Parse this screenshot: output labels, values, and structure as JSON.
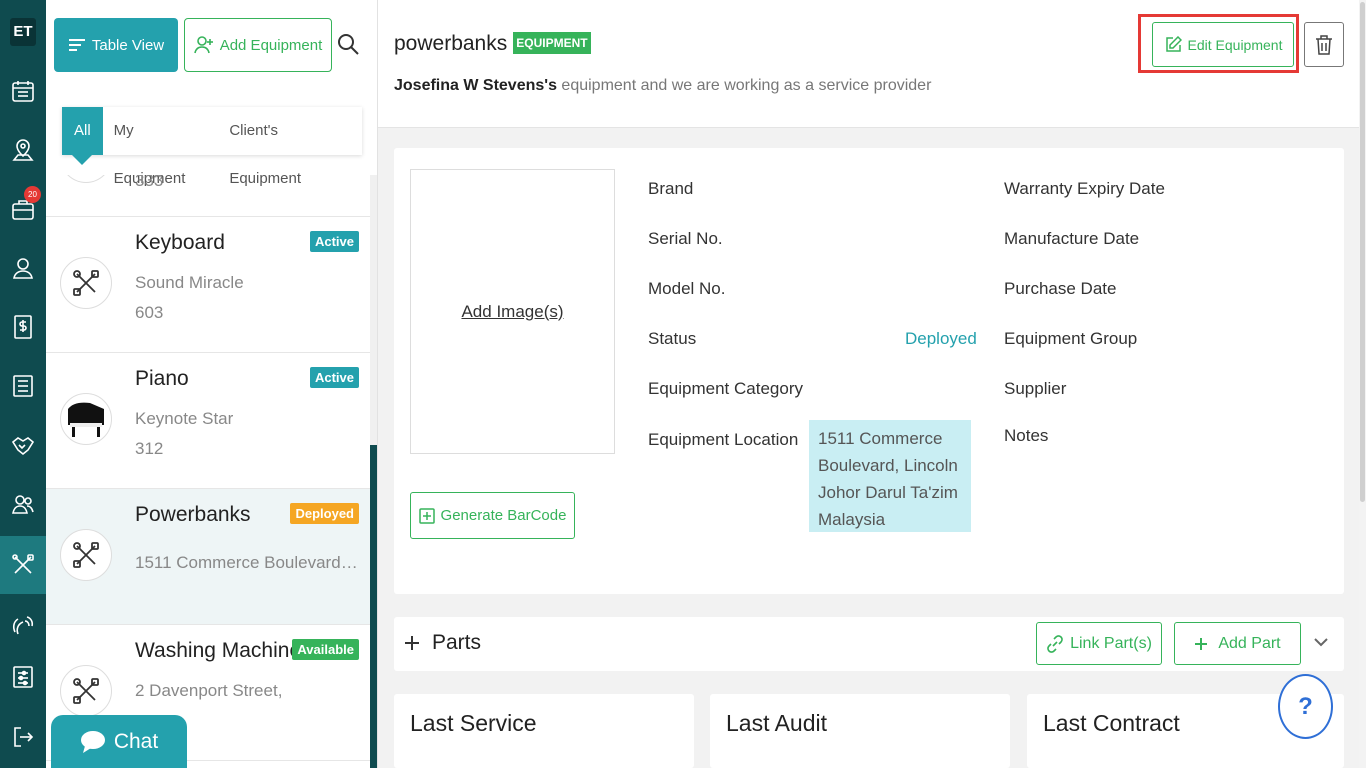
{
  "rail": {
    "logo": "ET",
    "badge": "20"
  },
  "list": {
    "table_view_label": "Table View",
    "add_equipment_label": "Add Equipment",
    "filters": [
      "All",
      "My Equipment",
      "Client's Equipment"
    ],
    "partial_item_line": "333",
    "items": [
      {
        "name": "Keyboard",
        "line2": "Sound Miracle",
        "line3": "603",
        "status": "Active",
        "status_color": "#24a1ad"
      },
      {
        "name": "Piano",
        "line2": "Keynote Star",
        "line3": "312",
        "status": "Active",
        "status_color": "#24a1ad"
      },
      {
        "name": "Powerbanks",
        "line2": "1511 Commerce Boulevard, Li...",
        "line3": "",
        "status": "Deployed",
        "status_color": "#f5a623"
      },
      {
        "name": "Washing Machine",
        "line2": "2 Davenport Street,",
        "line3": "",
        "status": "Available",
        "status_color": "#36b35a"
      }
    ],
    "chat_label": "Chat"
  },
  "header": {
    "title": "powerbanks",
    "tag": "EQUIPMENT",
    "owner": "Josefina W Stevens's",
    "subtitle_rest": " equipment and we are working as a service provider",
    "edit_label": "Edit Equipment"
  },
  "details": {
    "add_image_label": "Add Image(s)",
    "generate_barcode_label": "Generate BarCode",
    "brand_label": "Brand",
    "serial_label": "Serial No.",
    "model_label": "Model No.",
    "status_label": "Status",
    "status_value": "Deployed",
    "category_label": "Equipment Category",
    "location_label": "Equipment Location",
    "location_lines": [
      "1511 Commerce",
      "Boulevard, Lincoln",
      "Johor Darul Ta'zim",
      "Malaysia"
    ],
    "warranty_label": "Warranty Expiry Date",
    "manufacture_label": "Manufacture Date",
    "purchase_label": "Purchase Date",
    "group_label": "Equipment Group",
    "supplier_label": "Supplier",
    "notes_label": "Notes"
  },
  "parts": {
    "title": "Parts",
    "link_label": "Link Part(s)",
    "add_label": "Add Part"
  },
  "bottom": {
    "last_service": "Last Service",
    "last_audit": "Last Audit",
    "last_contract": "Last Contract"
  },
  "help_label": "?"
}
